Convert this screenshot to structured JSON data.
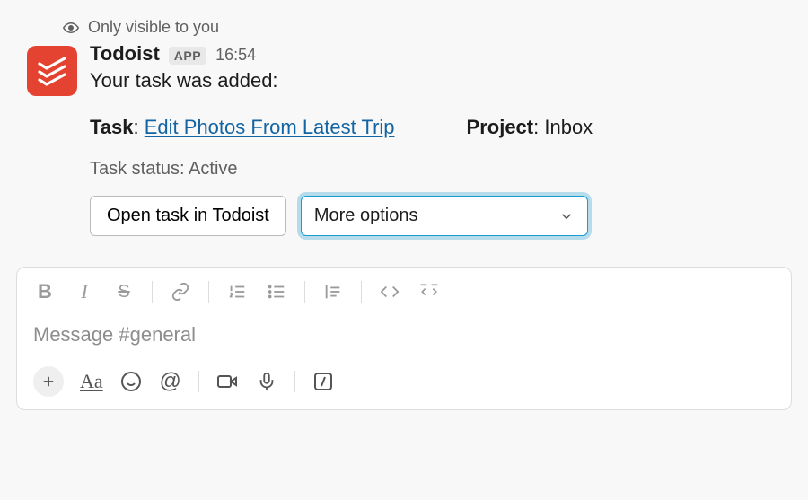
{
  "visibility": {
    "label": "Only visible to you"
  },
  "sender": {
    "name": "Todoist",
    "badge": "APP",
    "timestamp": "16:54"
  },
  "message": {
    "added_line": "Your task was added:",
    "task_label": "Task",
    "task_name": "Edit Photos From Latest Trip",
    "project_label": "Project",
    "project_name": "Inbox",
    "status_line": "Task status: Active"
  },
  "actions": {
    "open_task": "Open task in Todoist",
    "more_options": "More options"
  },
  "composer": {
    "placeholder": "Message #general"
  }
}
